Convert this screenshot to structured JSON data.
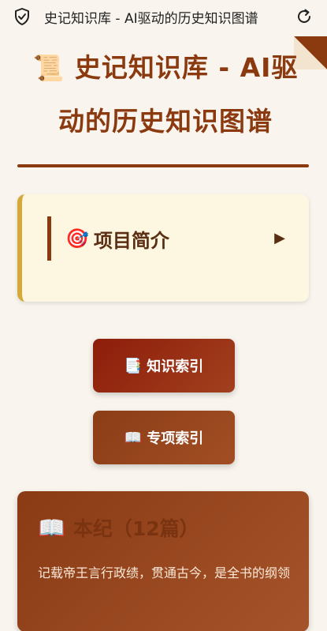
{
  "browser": {
    "tab_title": "史记知识库 - AI驱动的历史知识图谱"
  },
  "header": {
    "icon": "📜",
    "title": "史记知识库 - AI驱动的历史知识图谱"
  },
  "intro": {
    "icon": "🎯",
    "label": "项目简介",
    "arrow": "▶"
  },
  "buttons": {
    "knowledge_icon": "📑",
    "knowledge_label": "知识索引",
    "special_icon": "📖",
    "special_label": "专项索引"
  },
  "section": {
    "icon": "📖",
    "title": "本纪（12篇）",
    "description": "记载帝王言行政绩，贯通古今，是全书的纲领"
  },
  "colors": {
    "accent": "#8b3a10",
    "gold": "#d4a93a",
    "background": "#f9f5ee"
  }
}
